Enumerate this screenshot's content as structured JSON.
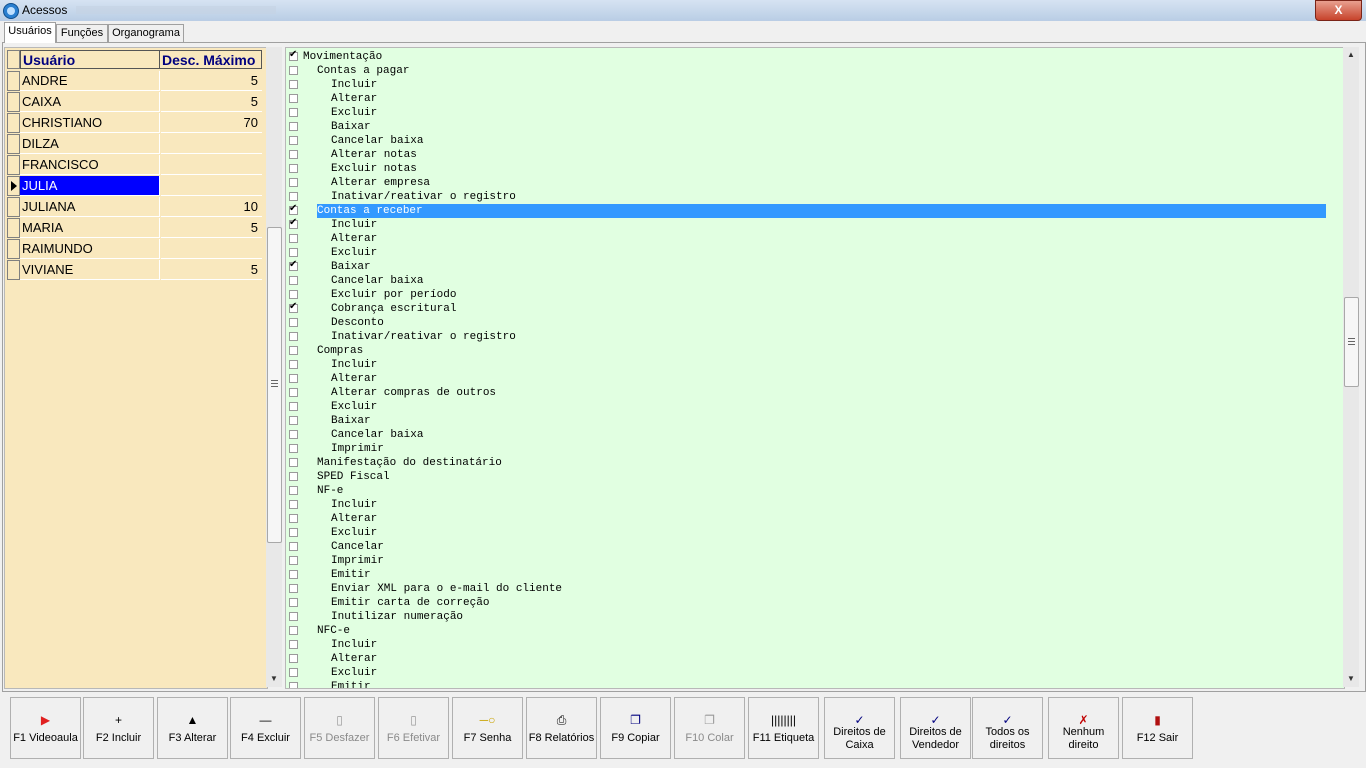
{
  "window": {
    "title": "Acessos",
    "close_label": "X"
  },
  "tabs": [
    {
      "label": "Usuários"
    },
    {
      "label": "Funções"
    },
    {
      "label": "Organograma"
    }
  ],
  "users": {
    "columns": {
      "name": "Usuário",
      "desc": "Desc. Máximo"
    },
    "rows": [
      {
        "name": "ANDRE",
        "desc": "5"
      },
      {
        "name": "CAIXA",
        "desc": "5"
      },
      {
        "name": "CHRISTIANO",
        "desc": "70"
      },
      {
        "name": "DILZA",
        "desc": ""
      },
      {
        "name": "FRANCISCO",
        "desc": ""
      },
      {
        "name": "JULIA",
        "desc": ""
      },
      {
        "name": "JULIANA",
        "desc": "10"
      },
      {
        "name": "MARIA",
        "desc": "5"
      },
      {
        "name": "RAIMUNDO",
        "desc": ""
      },
      {
        "name": "VIVIANE",
        "desc": "5"
      }
    ],
    "selected_user": "JULIA"
  },
  "permissions": [
    {
      "label": "Movimentação",
      "level": 0,
      "checked": true
    },
    {
      "label": "Contas a pagar",
      "level": 1,
      "checked": false
    },
    {
      "label": "Incluir",
      "level": 2,
      "checked": false
    },
    {
      "label": "Alterar",
      "level": 2,
      "checked": false
    },
    {
      "label": "Excluir",
      "level": 2,
      "checked": false
    },
    {
      "label": "Baixar",
      "level": 2,
      "checked": false
    },
    {
      "label": "Cancelar baixa",
      "level": 2,
      "checked": false
    },
    {
      "label": "Alterar notas",
      "level": 2,
      "checked": false
    },
    {
      "label": "Excluir notas",
      "level": 2,
      "checked": false
    },
    {
      "label": "Alterar empresa",
      "level": 2,
      "checked": false
    },
    {
      "label": "Inativar/reativar o registro",
      "level": 2,
      "checked": false
    },
    {
      "label": "Contas a receber",
      "level": 1,
      "checked": true,
      "selected": true
    },
    {
      "label": "Incluir",
      "level": 2,
      "checked": true
    },
    {
      "label": "Alterar",
      "level": 2,
      "checked": false
    },
    {
      "label": "Excluir",
      "level": 2,
      "checked": false
    },
    {
      "label": "Baixar",
      "level": 2,
      "checked": true
    },
    {
      "label": "Cancelar baixa",
      "level": 2,
      "checked": false
    },
    {
      "label": "Excluir por período",
      "level": 2,
      "checked": false
    },
    {
      "label": "Cobrança escritural",
      "level": 2,
      "checked": true
    },
    {
      "label": "Desconto",
      "level": 2,
      "checked": false
    },
    {
      "label": "Inativar/reativar o registro",
      "level": 2,
      "checked": false
    },
    {
      "label": "Compras",
      "level": 1,
      "checked": false
    },
    {
      "label": "Incluir",
      "level": 2,
      "checked": false
    },
    {
      "label": "Alterar",
      "level": 2,
      "checked": false
    },
    {
      "label": "Alterar compras de outros",
      "level": 2,
      "checked": false
    },
    {
      "label": "Excluir",
      "level": 2,
      "checked": false
    },
    {
      "label": "Baixar",
      "level": 2,
      "checked": false
    },
    {
      "label": "Cancelar baixa",
      "level": 2,
      "checked": false
    },
    {
      "label": "Imprimir",
      "level": 2,
      "checked": false
    },
    {
      "label": "Manifestação do destinatário",
      "level": 1,
      "checked": false
    },
    {
      "label": "SPED Fiscal",
      "level": 1,
      "checked": false
    },
    {
      "label": "NF-e",
      "level": 1,
      "checked": false
    },
    {
      "label": "Incluir",
      "level": 2,
      "checked": false
    },
    {
      "label": "Alterar",
      "level": 2,
      "checked": false
    },
    {
      "label": "Excluir",
      "level": 2,
      "checked": false
    },
    {
      "label": "Cancelar",
      "level": 2,
      "checked": false
    },
    {
      "label": "Imprimir",
      "level": 2,
      "checked": false
    },
    {
      "label": "Emitir",
      "level": 2,
      "checked": false
    },
    {
      "label": "Enviar XML para o e-mail do cliente",
      "level": 2,
      "checked": false
    },
    {
      "label": "Emitir carta de correção",
      "level": 2,
      "checked": false
    },
    {
      "label": "Inutilizar numeração",
      "level": 2,
      "checked": false
    },
    {
      "label": "NFC-e",
      "level": 1,
      "checked": false
    },
    {
      "label": "Incluir",
      "level": 2,
      "checked": false
    },
    {
      "label": "Alterar",
      "level": 2,
      "checked": false
    },
    {
      "label": "Excluir",
      "level": 2,
      "checked": false
    },
    {
      "label": "Emitir",
      "level": 2,
      "checked": false
    }
  ],
  "toolbar": [
    {
      "name": "videoaula-button",
      "label": "F1 Videoaula",
      "icon": "video-icon",
      "glyph": "▶",
      "color": "#e02020",
      "enabled": true
    },
    {
      "name": "incluir-button",
      "label": "F2 Incluir",
      "icon": "plus-icon",
      "glyph": "+",
      "color": "#000000",
      "enabled": true
    },
    {
      "name": "alterar-button",
      "label": "F3 Alterar",
      "icon": "triangle-up-icon",
      "glyph": "▲",
      "color": "#000000",
      "enabled": true
    },
    {
      "name": "excluir-button",
      "label": "F4 Excluir",
      "icon": "minus-icon",
      "glyph": "—",
      "color": "#000000",
      "enabled": true
    },
    {
      "name": "desfazer-button",
      "label": "F5 Desfazer",
      "icon": "page-icon",
      "glyph": "▯",
      "color": "#9a9a9a",
      "enabled": false
    },
    {
      "name": "efetivar-button",
      "label": "F6 Efetivar",
      "icon": "page-icon",
      "glyph": "▯",
      "color": "#9a9a9a",
      "enabled": false
    },
    {
      "name": "senha-button",
      "label": "F7 Senha",
      "icon": "key-icon",
      "glyph": "─○",
      "color": "#c9a300",
      "enabled": true
    },
    {
      "name": "relatorios-button",
      "label": "F8 Relatórios",
      "icon": "printer-icon",
      "glyph": "⎙",
      "color": "#000000",
      "enabled": true
    },
    {
      "name": "copiar-button",
      "label": "F9 Copiar",
      "icon": "copy-icon",
      "glyph": "❐",
      "color": "#00007f",
      "enabled": true
    },
    {
      "name": "colar-button",
      "label": "F10 Colar",
      "icon": "paste-icon",
      "glyph": "❐",
      "color": "#9a9a9a",
      "enabled": false
    },
    {
      "name": "etiqueta-button",
      "label": "F11 Etiqueta",
      "icon": "barcode-icon",
      "glyph": "||||||||",
      "color": "#000000",
      "enabled": true
    },
    {
      "name": "direitos-caixa-button",
      "label": "Direitos de Caixa",
      "icon": "doc-check-icon",
      "glyph": "✓",
      "color": "#00007f",
      "enabled": true
    },
    {
      "name": "direitos-vendedor-button",
      "label": "Direitos de Vendedor",
      "icon": "doc-check-icon",
      "glyph": "✓",
      "color": "#00007f",
      "enabled": true
    },
    {
      "name": "todos-direitos-button",
      "label": "Todos os direitos",
      "icon": "doc-check-icon",
      "glyph": "✓",
      "color": "#00007f",
      "enabled": true
    },
    {
      "name": "nenhum-direito-button",
      "label": "Nenhum direito",
      "icon": "doc-x-icon",
      "glyph": "✗",
      "color": "#c00000",
      "enabled": true
    },
    {
      "name": "sair-button",
      "label": "F12 Sair",
      "icon": "exit-door-icon",
      "glyph": "▮",
      "color": "#b01010",
      "enabled": true
    }
  ]
}
